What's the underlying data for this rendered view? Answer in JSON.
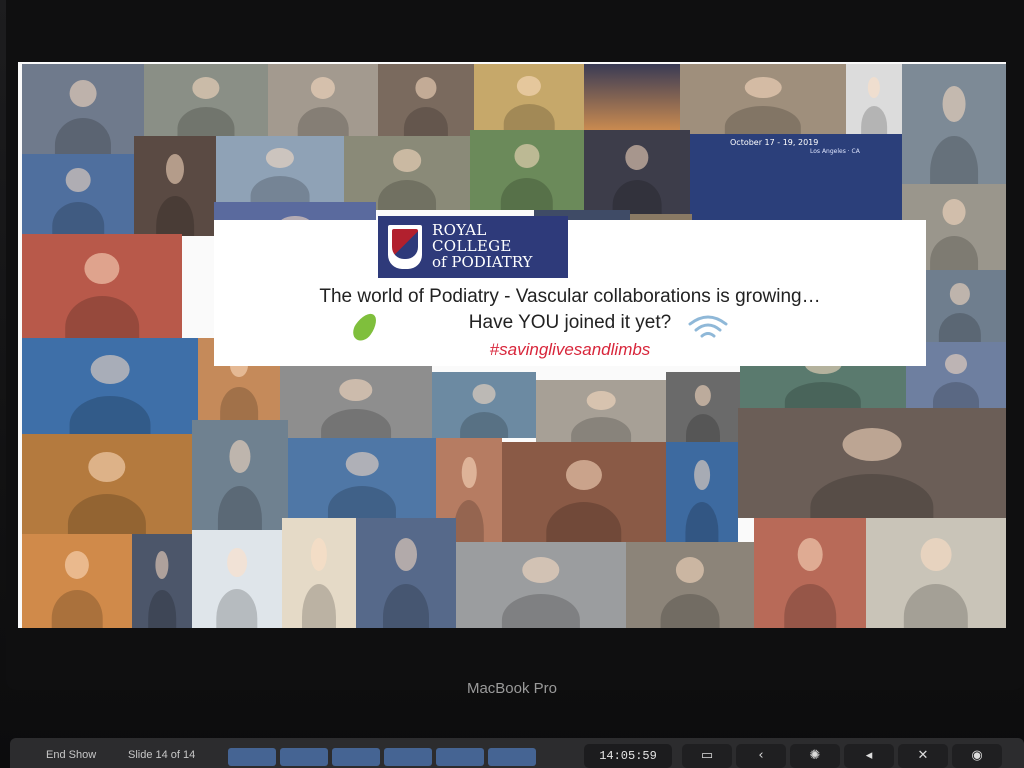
{
  "slide": {
    "logo_line1": "ROYAL COLLEGE",
    "logo_line2": "of PODIATRY",
    "headline_line1": "The world of Podiatry - Vascular collaborations is growing…",
    "headline_line2": "Have YOU joined it yet?",
    "hashtag": "#savinglivesandlimbs",
    "banner_date": "October 17 - 19, 2019",
    "banner_place": "Los Angeles · CA"
  },
  "device": {
    "brand": "MacBook Pro"
  },
  "touchbar": {
    "end_show": "End Show",
    "slide_counter": "Slide 14 of 14",
    "time": "14:05:59",
    "keys": [
      "▭",
      "‹",
      "✺",
      "◂",
      "✕",
      "◉"
    ]
  },
  "colors": {
    "logo_bg": "#2e3a7a",
    "hashtag": "#d8263b"
  },
  "icons": {
    "logo": "college-crest-icon",
    "decoration": "pea-pod-icon",
    "signal": "wifi-icon"
  }
}
